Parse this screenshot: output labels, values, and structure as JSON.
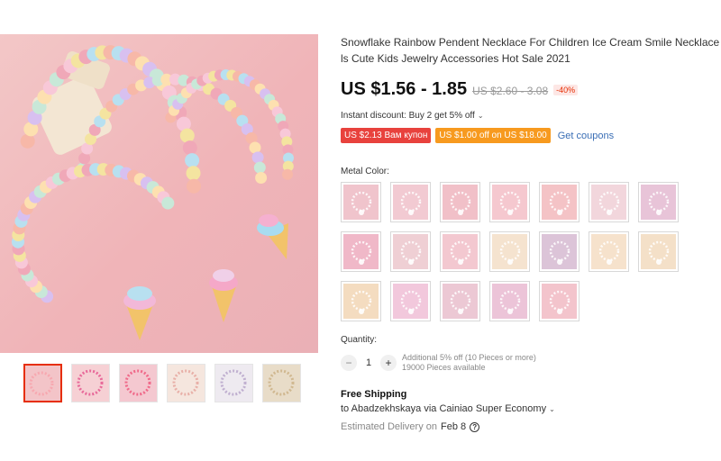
{
  "product": {
    "title_line1": "Snowflake Rainbow Pendent Necklace For Children Ice Cream Smile Necklace For G",
    "title_line2": "ls Cute Kids Jewelry Accessories Hot Sale 2021"
  },
  "pricing": {
    "price": "US $1.56 - 1.85",
    "original_price": "US $2.60 - 3.08",
    "discount": "-40%"
  },
  "promotions": {
    "instant_discount": "Instant discount: Buy 2 get 5% off",
    "coupon1": "US $2.13 Вам купон",
    "coupon2": "US $1.00 off on US $18.00",
    "get_coupons": "Get coupons"
  },
  "options": {
    "metal_color_label": "Metal Color:",
    "swatch_colors": [
      "#f0c4cc",
      "#f2cad2",
      "#f1c0c8",
      "#f5c8cf",
      "#f4c3c6",
      "#f2d6dc",
      "#e8c4d8",
      "#f0b8c8",
      "#efcfd4",
      "#f3c8d0",
      "#f5e3cf",
      "#dcc4d8",
      "#f6e2cc",
      "#f4e0c8",
      "#f4dcc0",
      "#f2c8dc",
      "#ecc8d4",
      "#ecc4d8",
      "#f3c4cc"
    ]
  },
  "quantity": {
    "label": "Quantity:",
    "minus": "−",
    "value": "1",
    "plus": "+",
    "note1": "Additional 5% off (10 Pieces or more)",
    "note2": "19000 Pieces available"
  },
  "shipping": {
    "title": "Free Shipping",
    "route": "to Abadzekhskaya via Cainiao Super Economy",
    "delivery_label": "Estimated Delivery on",
    "delivery_date": "Feb 8"
  },
  "icons": {
    "chevron": "⌄",
    "help": "?"
  }
}
